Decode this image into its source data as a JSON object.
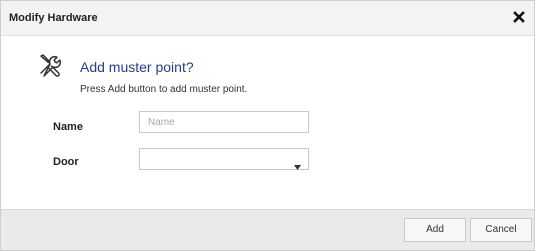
{
  "window": {
    "title": "Modify Hardware",
    "close_icon": "close-icon"
  },
  "header": {
    "icon": "tools-icon",
    "heading": "Add muster point?",
    "subtext": "Press Add button to add muster point."
  },
  "form": {
    "name": {
      "label": "Name",
      "value": "",
      "placeholder": "Name"
    },
    "door": {
      "label": "Door",
      "selected": ""
    }
  },
  "footer": {
    "add_label": "Add",
    "cancel_label": "Cancel"
  },
  "colors": {
    "heading": "#2b3a8f",
    "titlebar": "#f3f3f3",
    "footer": "#eaeaea"
  }
}
